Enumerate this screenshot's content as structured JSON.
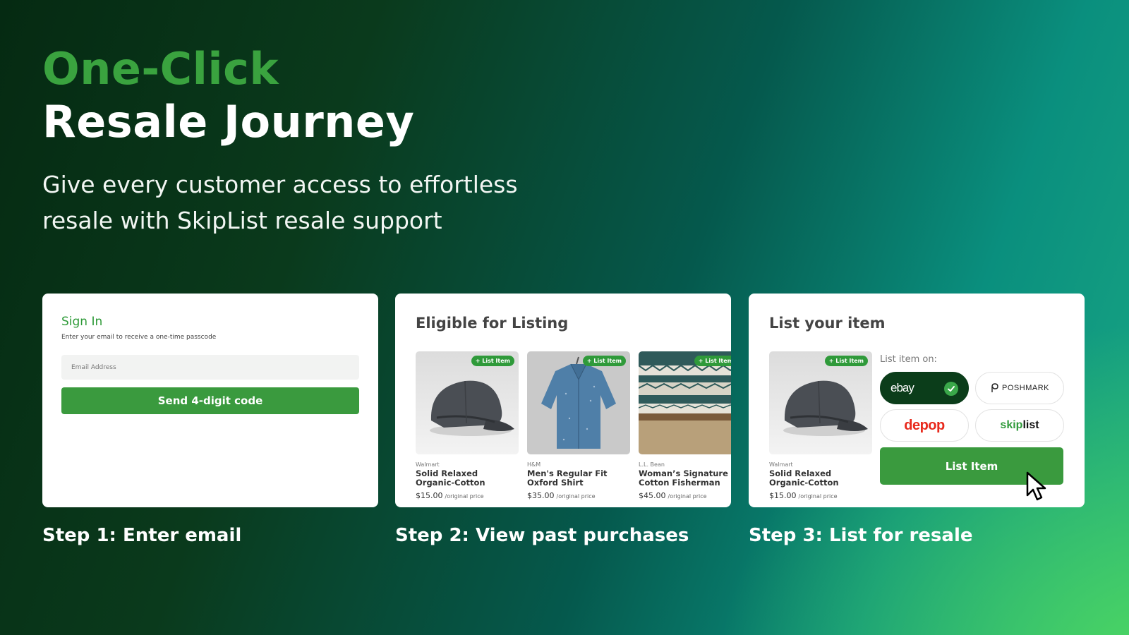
{
  "hero": {
    "headline_green": "One-Click",
    "headline_white": "Resale Journey",
    "subtitle_line1": "Give every customer access to effortless",
    "subtitle_line2": "resale with SkipList resale support"
  },
  "steps": [
    {
      "label": "Step 1: Enter email"
    },
    {
      "label": "Step 2: View past purchases"
    },
    {
      "label": "Step 3: List for resale"
    }
  ],
  "signin": {
    "title": "Sign In",
    "subtitle": "Enter your email to receive a one-time passcode",
    "email_placeholder": "Email Address",
    "send_button": "Send 4-digit code"
  },
  "eligible": {
    "title": "Eligible for Listing",
    "badge": "+ List Item",
    "products": [
      {
        "store": "Walmart",
        "name": "Solid Relaxed Organic-Cotton Sateen Duvet C...",
        "price": "$15.00",
        "price_note": "/original price",
        "image": "cap-image"
      },
      {
        "store": "H&M",
        "name": "Men's Regular Fit Oxford Shirt",
        "price": "$35.00",
        "price_note": "/original price",
        "image": "shirt-image"
      },
      {
        "store": "L.L. Bean",
        "name": "Woman’s Signature Cotton Fisherman",
        "price": "$45.00",
        "price_note": "/original price",
        "image": "sweater-image"
      }
    ]
  },
  "list_item": {
    "title": "List your item",
    "badge": "+ List Item",
    "product": {
      "store": "Walmart",
      "name": "Solid Relaxed Organic-Cotton Sateen Duvet C...",
      "price": "$15.00",
      "price_note": "/original price"
    },
    "list_on_label": "List item on:",
    "platforms": {
      "ebay": "ebay",
      "poshmark": "POSHMARK",
      "depop": "depop",
      "skiplist_a": "skip",
      "skiplist_b": "list"
    },
    "selected_platform": "ebay",
    "button": "List Item"
  },
  "colors": {
    "brand_green": "#3a9a3e",
    "headline_green": "#3aa33f",
    "depop_red": "#e8291c",
    "ebay_bg": "#0b3d1a"
  }
}
